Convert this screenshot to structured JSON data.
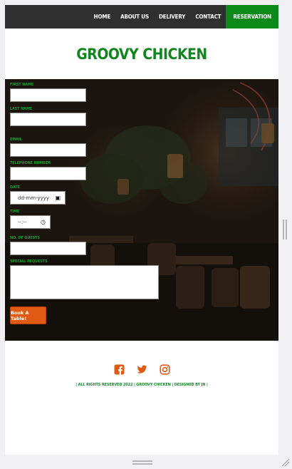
{
  "nav": {
    "items": [
      {
        "label": "HOME"
      },
      {
        "label": "ABOUT US"
      },
      {
        "label": "DELIVERY"
      },
      {
        "label": "CONTACT"
      },
      {
        "label": "RESERVATION"
      }
    ]
  },
  "brand": {
    "title": "GROOVY CHICKEN"
  },
  "form": {
    "first_name_label": "FIRST NAME",
    "last_name_label": "LAST NAME",
    "email_label": "EMAIL",
    "telephone_label": "TELEPHONE NUMBER",
    "date_label": "DATE",
    "date_placeholder": "dd-mm-yyyy",
    "time_label": "TIME",
    "time_placeholder": "--:--",
    "guests_label": "NO. OF GUESTS",
    "requests_label": "SPECIAL REQUESTS",
    "submit_label": "Book A Table!"
  },
  "footer": {
    "social": [
      "facebook-icon",
      "twitter-icon",
      "instagram-icon"
    ],
    "text": "| ALL RIGHTS RESERVED 2022 | GROOVY CHICKEN | DESIGNED BY JN |"
  },
  "colors": {
    "nav_bg": "#2f2f30",
    "active": "#0b8a1a",
    "brand_green": "#11861f",
    "label_green": "#14a02b",
    "button_orange": "#e05a12",
    "icon_orange": "#e05a12"
  }
}
